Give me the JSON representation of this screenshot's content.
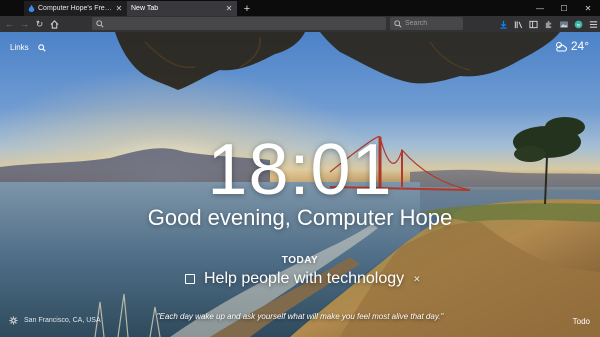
{
  "tabs": [
    {
      "title": "Computer Hope's Free Compu",
      "active": false,
      "favicon": "computerhope-icon"
    },
    {
      "title": "New Tab",
      "active": true
    }
  ],
  "toolbar": {
    "url_value": "",
    "search_placeholder": "Search"
  },
  "page": {
    "links_label": "Links",
    "weather": {
      "temperature": "24°",
      "condition_icon": "partly-cloudy-icon"
    },
    "clock": "18:01",
    "greeting": "Good evening, Computer Hope",
    "today_label": "TODAY",
    "focus": "Help people with technology",
    "location": "San Francisco, CA, USA",
    "quote": "\"Each day wake up and ask yourself what will make you feel most alive that day.\"",
    "todo_label": "Todo"
  },
  "colors": {
    "tabstrip_bg": "#0c0c0d",
    "toolbar_bg": "#323234",
    "urlbar_bg": "#474749",
    "download_accent": "#0a84ff"
  }
}
